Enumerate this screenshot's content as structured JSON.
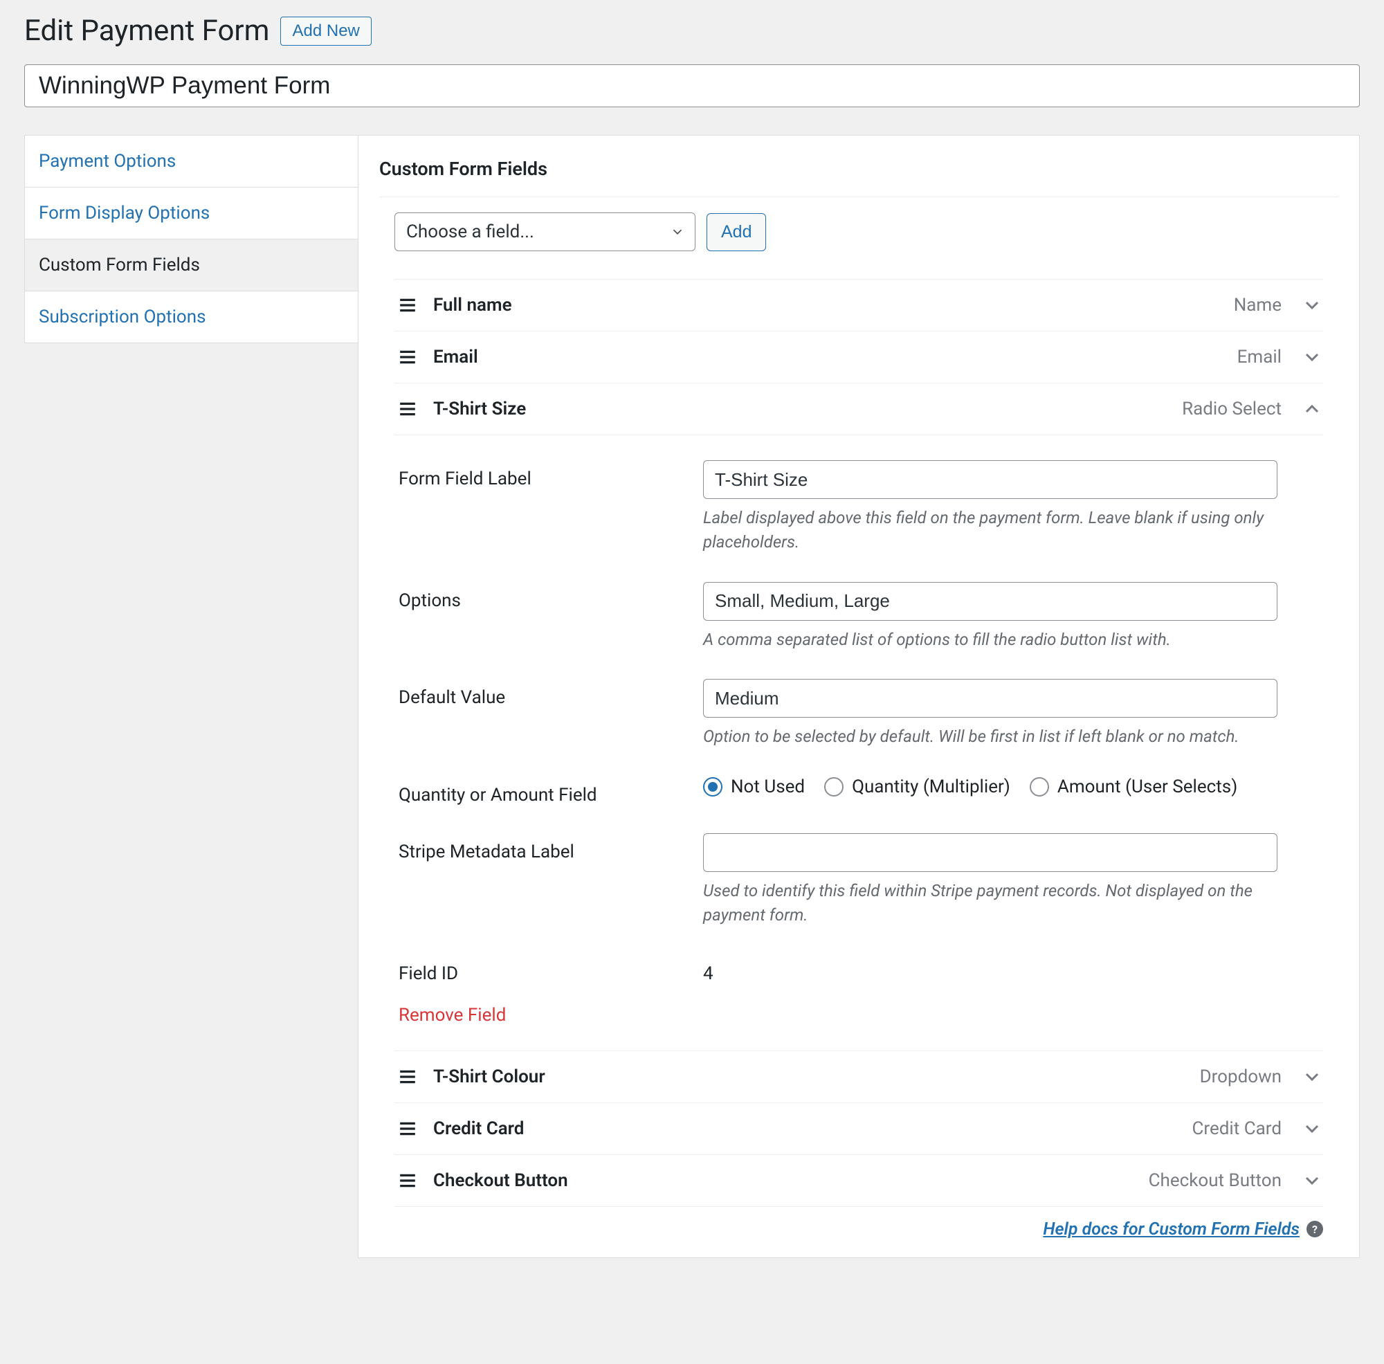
{
  "header": {
    "page_title": "Edit Payment Form",
    "add_new_label": "Add New"
  },
  "title_input": {
    "value": "WinningWP Payment Form"
  },
  "sidebar": {
    "items": [
      {
        "label": "Payment Options",
        "active": false
      },
      {
        "label": "Form Display Options",
        "active": false
      },
      {
        "label": "Custom Form Fields",
        "active": true
      },
      {
        "label": "Subscription Options",
        "active": false
      }
    ]
  },
  "panel": {
    "heading": "Custom Form Fields",
    "chooser_placeholder": "Choose a field...",
    "add_button_label": "Add",
    "fields": [
      {
        "name": "Full name",
        "type": "Name",
        "expanded": false
      },
      {
        "name": "Email",
        "type": "Email",
        "expanded": false
      },
      {
        "name": "T-Shirt Size",
        "type": "Radio Select",
        "expanded": true
      },
      {
        "name": "T-Shirt Colour",
        "type": "Dropdown",
        "expanded": false
      },
      {
        "name": "Credit Card",
        "type": "Credit Card",
        "expanded": false
      },
      {
        "name": "Checkout Button",
        "type": "Checkout Button",
        "expanded": false
      }
    ],
    "expanded": {
      "labels": {
        "form_field_label": "Form Field Label",
        "options": "Options",
        "default_value": "Default Value",
        "qty_amount": "Quantity or Amount Field",
        "stripe_meta": "Stripe Metadata Label",
        "field_id": "Field ID"
      },
      "values": {
        "form_field_label": "T-Shirt Size",
        "options": "Small, Medium, Large",
        "default_value": "Medium",
        "stripe_meta": "",
        "field_id": "4"
      },
      "help": {
        "form_field_label": "Label displayed above this field on the payment form. Leave blank if using only placeholders.",
        "options": "A comma separated list of options to fill the radio button list with.",
        "default_value": "Option to be selected by default. Will be first in list if left blank or no match.",
        "stripe_meta": "Used to identify this field within Stripe payment records. Not displayed on the payment form."
      },
      "qty_amount_options": {
        "opt0": "Not Used",
        "opt1": "Quantity (Multiplier)",
        "opt2": "Amount (User Selects)"
      },
      "remove_label": "Remove Field"
    },
    "help_docs_label": "Help docs for Custom Form Fields"
  }
}
